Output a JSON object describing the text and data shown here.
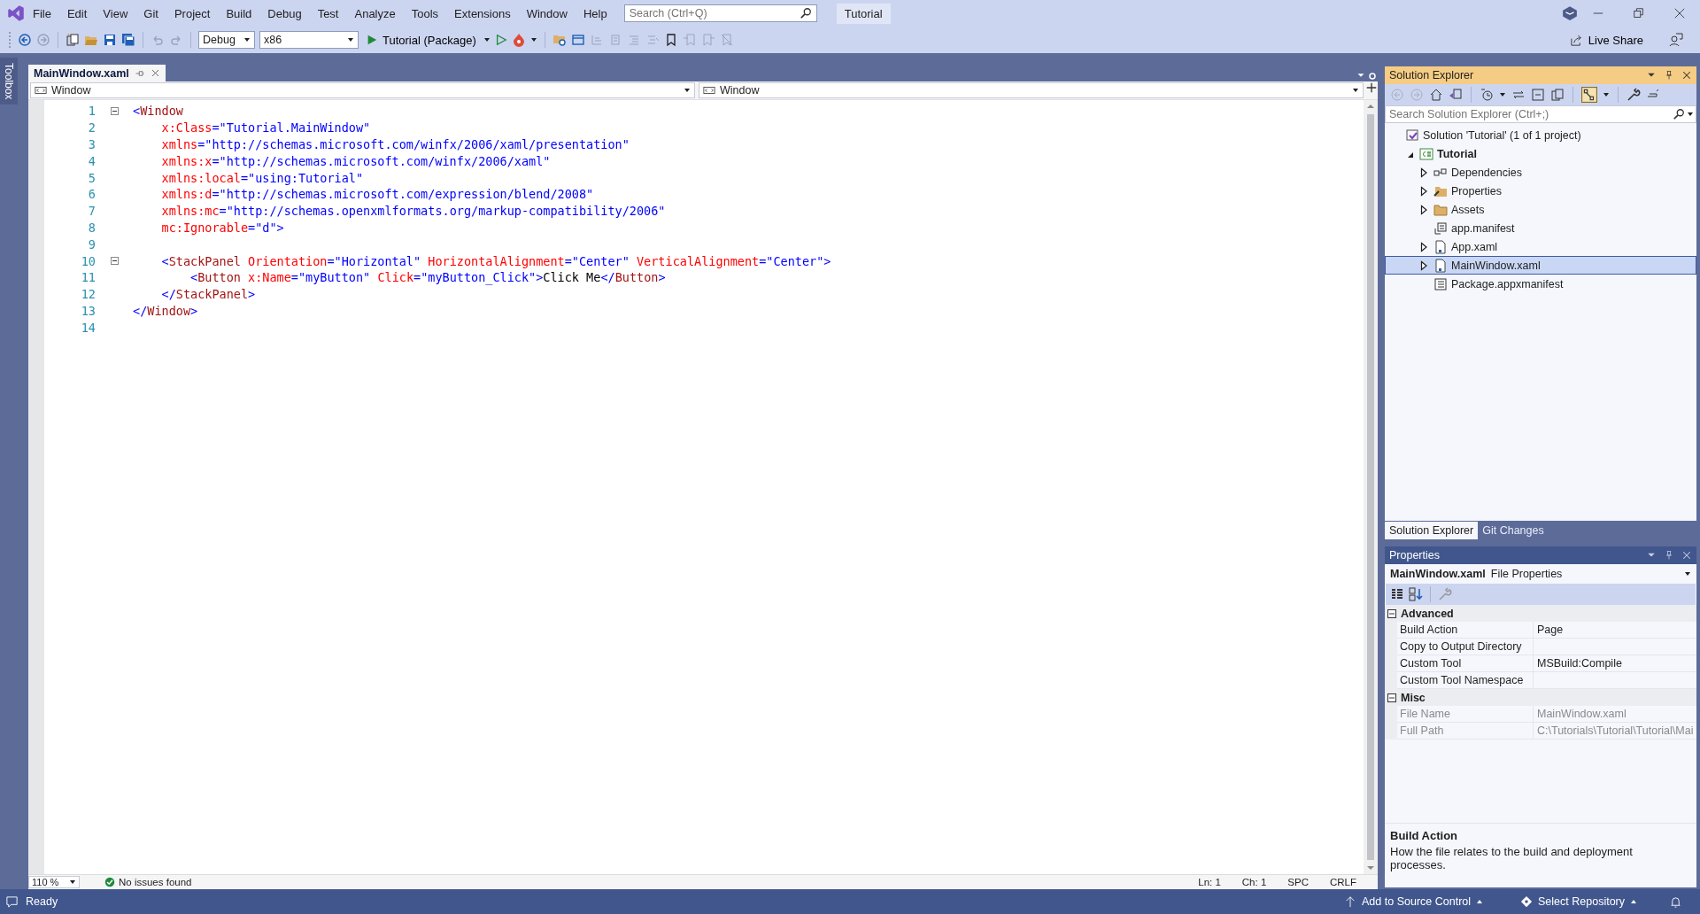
{
  "menu_bar": {
    "menus": [
      "File",
      "Edit",
      "View",
      "Git",
      "Project",
      "Build",
      "Debug",
      "Test",
      "Analyze",
      "Tools",
      "Extensions",
      "Window",
      "Help"
    ],
    "search": {
      "placeholder": "Search (Ctrl+Q)"
    },
    "solution_badge": "Tutorial"
  },
  "toolbar": {
    "configuration": "Debug",
    "platform": "x86",
    "run_target": "Tutorial (Package)",
    "live_share": "Live Share"
  },
  "toolbox": {
    "label": "Toolbox"
  },
  "editor": {
    "tabs": [
      {
        "label": "MainWindow.xaml",
        "selected": true
      }
    ],
    "nav": [
      "Window",
      "Window"
    ],
    "lines": [
      {
        "number": "1",
        "collapsible": true,
        "tokens": [
          {
            "kind": "punct",
            "text": "<"
          },
          {
            "kind": "tag",
            "text": "Window"
          }
        ]
      },
      {
        "number": "2",
        "collapsible": false,
        "tokens": [
          {
            "kind": "attr",
            "text": "    x:Class"
          },
          {
            "kind": "value",
            "text": "=\"Tutorial.MainWindow\""
          }
        ]
      },
      {
        "number": "3",
        "collapsible": false,
        "tokens": [
          {
            "kind": "attr",
            "text": "    xmlns"
          },
          {
            "kind": "value",
            "text": "=\"http://schemas.microsoft.com/winfx/2006/xaml/presentation\""
          }
        ]
      },
      {
        "number": "4",
        "collapsible": false,
        "tokens": [
          {
            "kind": "attr",
            "text": "    xmlns:x"
          },
          {
            "kind": "value",
            "text": "=\"http://schemas.microsoft.com/winfx/2006/xaml\""
          }
        ]
      },
      {
        "number": "5",
        "collapsible": false,
        "tokens": [
          {
            "kind": "attr",
            "text": "    xmlns:local"
          },
          {
            "kind": "value",
            "text": "=\"using:Tutorial\""
          }
        ]
      },
      {
        "number": "6",
        "collapsible": false,
        "tokens": [
          {
            "kind": "attr",
            "text": "    xmlns:d"
          },
          {
            "kind": "value",
            "text": "=\"http://schemas.microsoft.com/expression/blend/2008\""
          }
        ]
      },
      {
        "number": "7",
        "collapsible": false,
        "tokens": [
          {
            "kind": "attr",
            "text": "    xmlns:mc"
          },
          {
            "kind": "value",
            "text": "=\"http://schemas.openxmlformats.org/markup-compatibility/2006\""
          }
        ]
      },
      {
        "number": "8",
        "collapsible": false,
        "tokens": [
          {
            "kind": "attr",
            "text": "    mc:Ignorable"
          },
          {
            "kind": "value",
            "text": "=\"d\">"
          }
        ]
      },
      {
        "number": "9",
        "collapsible": false
      },
      {
        "number": "10",
        "collapsible": true,
        "tokens": [
          {
            "kind": "punct",
            "text": "    <"
          },
          {
            "kind": "tag",
            "text": "StackPanel"
          },
          {
            "kind": "attr",
            "text": " Orientation"
          },
          {
            "kind": "value",
            "text": "=\"Horizontal\""
          },
          {
            "kind": "attr",
            "text": " HorizontalAlignment"
          },
          {
            "kind": "value",
            "text": "=\"Center\""
          },
          {
            "kind": "attr",
            "text": " VerticalAlignment"
          },
          {
            "kind": "value",
            "text": "=\"Center\">"
          }
        ]
      },
      {
        "number": "11",
        "collapsible": false,
        "tokens": [
          {
            "kind": "punct",
            "text": "        <"
          },
          {
            "kind": "tag",
            "text": "Button"
          },
          {
            "kind": "attr",
            "text": " x:Name"
          },
          {
            "kind": "value",
            "text": "=\"myButton\""
          },
          {
            "kind": "attr",
            "text": " Click"
          },
          {
            "kind": "value",
            "text": "=\"myButton_Click\">"
          },
          {
            "kind": "text",
            "text": "Click Me"
          },
          {
            "kind": "punct",
            "text": "</"
          },
          {
            "kind": "tag",
            "text": "Button"
          },
          {
            "kind": "punct",
            "text": ">"
          }
        ]
      },
      {
        "number": "12",
        "collapsible": false,
        "tokens": [
          {
            "kind": "punct",
            "text": "    </"
          },
          {
            "kind": "tag",
            "text": "StackPanel"
          },
          {
            "kind": "punct",
            "text": ">"
          }
        ]
      },
      {
        "number": "13",
        "collapsible": false,
        "tokens": [
          {
            "kind": "punct",
            "text": "</"
          },
          {
            "kind": "tag",
            "text": "Window"
          },
          {
            "kind": "punct",
            "text": ">"
          }
        ]
      },
      {
        "number": "14",
        "collapsible": false
      }
    ],
    "zoom": "110 %",
    "issues": "No issues found",
    "position": [
      "Ln: 1",
      "Ch: 1",
      "SPC",
      "CRLF"
    ]
  },
  "solution_explorer": {
    "title": "Solution Explorer",
    "search": {
      "placeholder": "Search Solution Explorer (Ctrl+;)"
    },
    "tree": [
      {
        "label": "Solution 'Tutorial' (1 of 1 project)",
        "kind": "solution",
        "selected": false,
        "children": [
          {
            "label": "Tutorial",
            "kind": "project",
            "expanded": true,
            "selected": false,
            "children": [
              {
                "label": "Dependencies",
                "kind": "dependencies",
                "expanded": false,
                "selected": false
              },
              {
                "label": "Properties",
                "kind": "properties",
                "expanded": false,
                "selected": false
              },
              {
                "label": "Assets",
                "kind": "folder",
                "expanded": false,
                "selected": false
              },
              {
                "label": "app.manifest",
                "kind": "manifest",
                "selected": false
              },
              {
                "label": "App.xaml",
                "kind": "xaml",
                "expanded": false,
                "selected": false
              },
              {
                "label": "MainWindow.xaml",
                "kind": "xaml",
                "expanded": false,
                "selected": true
              },
              {
                "label": "Package.appxmanifest",
                "kind": "appxmanifest",
                "selected": false
              }
            ]
          }
        ]
      }
    ],
    "tabs": [
      {
        "label": "Solution Explorer",
        "selected": true
      },
      {
        "label": "Git Changes",
        "selected": false
      }
    ]
  },
  "properties": {
    "title": "Properties",
    "object_name": "MainWindow.xaml",
    "object_type": "File Properties",
    "sections": [
      {
        "name": "Advanced",
        "expanded": true,
        "rows": [
          {
            "name": "Build Action",
            "value": "Page",
            "disabled": false
          },
          {
            "name": "Copy to Output Directory",
            "disabled": false
          },
          {
            "name": "Custom Tool",
            "value": "MSBuild:Compile",
            "disabled": false
          },
          {
            "name": "Custom Tool Namespace",
            "disabled": false
          }
        ]
      },
      {
        "name": "Misc",
        "expanded": true,
        "rows": [
          {
            "name": "File Name",
            "value": "MainWindow.xaml",
            "disabled": true
          },
          {
            "name": "Full Path",
            "value": "C:\\Tutorials\\Tutorial\\Tutorial\\Mai",
            "disabled": true
          }
        ]
      }
    ],
    "description": {
      "title": "Build Action",
      "text": "How the file relates to the build and deployment processes."
    }
  },
  "status_bar": {
    "text": "Ready",
    "items": [
      "Add to Source Control",
      "Select Repository"
    ]
  }
}
